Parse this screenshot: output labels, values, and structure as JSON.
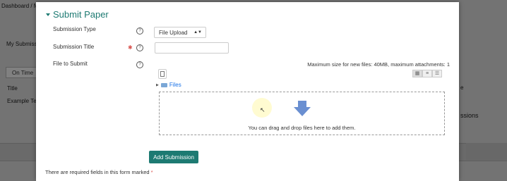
{
  "background": {
    "breadcrumb": "Dashboard / M",
    "my_submission": "My Submissi",
    "tab_label": "On Time",
    "title_label": "Title",
    "example_label": "Example Te",
    "right_text_1": "e",
    "right_text_2": "",
    "right_text_3": "ssions"
  },
  "modal": {
    "legend": "Submit Paper",
    "submission_type": {
      "label": "Submission Type",
      "value": "File Upload"
    },
    "submission_title": {
      "label": "Submission Title",
      "value": ""
    },
    "file_to_submit": {
      "label": "File to Submit",
      "max_size": "Maximum size for new files: 40MB, maximum attachments: 1",
      "files_label": "Files",
      "drop_hint": "You can drag and drop files here to add them."
    },
    "add_button": "Add Submission",
    "required_note": "There are required fields in this form marked",
    "required_star": "*"
  },
  "colors": {
    "accent": "#1d7a72",
    "required": "#d9534f",
    "link": "#1a73e8"
  }
}
